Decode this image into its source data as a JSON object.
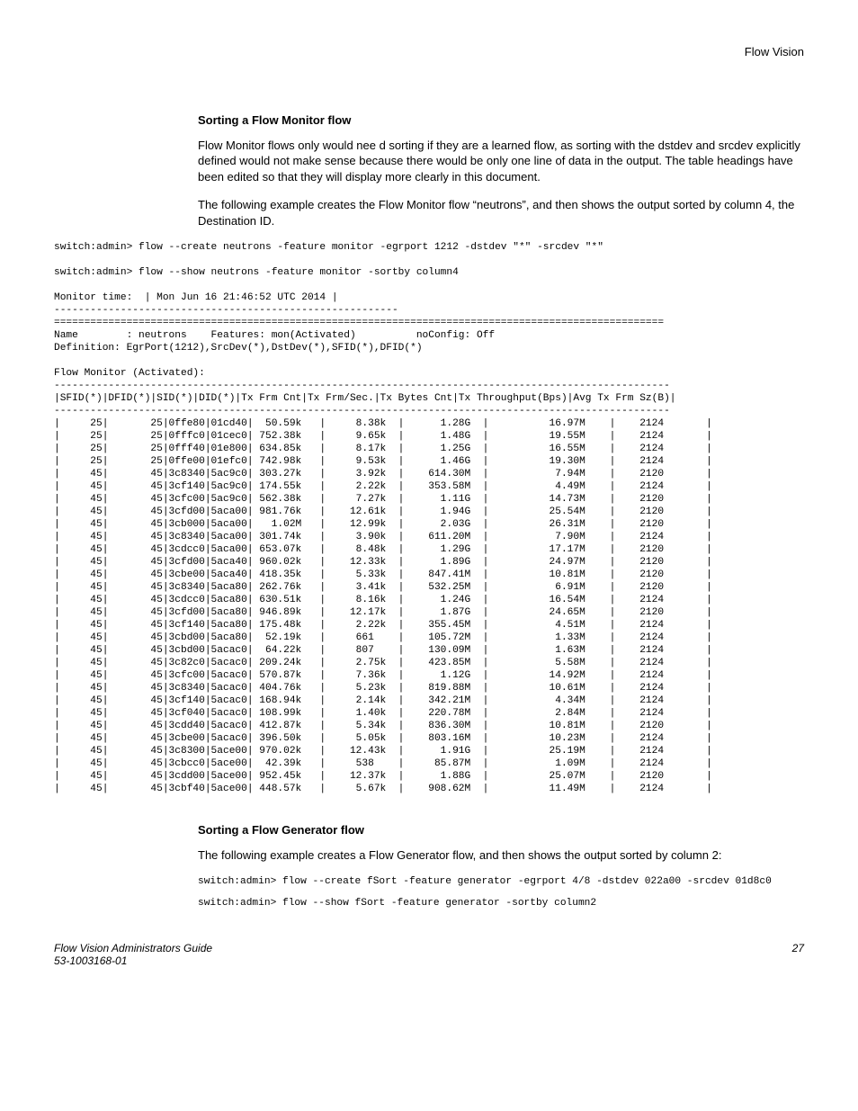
{
  "running_head": "Flow Vision",
  "section1": {
    "heading": "Sorting a Flow Monitor flow",
    "para1": "Flow Monitor flows only would nee d sorting if they are a learned flow, as sorting with the dstdev and srcdev explicitly defined would not make sense because there would be only one line of data in the output. The table headings have been edited so that they will display more clearly in this document.",
    "para2": "The following example creates the Flow Monitor flow “neutrons”, and then shows the output sorted by column 4, the Destination ID."
  },
  "console1": {
    "cmd1": "switch:admin> flow --create neutrons -feature monitor -egrport 1212 -dstdev \"*\" -srcdev \"*\"",
    "cmd2": "switch:admin> flow --show neutrons -feature monitor -sortby column4",
    "monitor_time": "Monitor time:  | Mon Jun 16 21:46:52 UTC 2014 |",
    "dash_line_short": "---------------------------------------------------------",
    "eq_line": "=====================================================================================================",
    "name_line": "Name        : neutrons    Features: mon(Activated)          noConfig: Off",
    "def_line": "Definition: EgrPort(1212),SrcDev(*),DstDev(*),SFID(*),DFID(*)",
    "blank": "",
    "flow_mon": "Flow Monitor (Activated):",
    "dash_line_long": "------------------------------------------------------------------------------------------------------",
    "header_row": "|SFID(*)|DFID(*)|SID(*)|DID(*)|Tx Frm Cnt|Tx Frm/Sec.|Tx Bytes Cnt|Tx Throughput(Bps)|Avg Tx Frm Sz(B)|",
    "rows": [
      "|     25|       25|0ffe80|01cd40|  50.59k   |     8.38k  |      1.28G  |          16.97M    |    2124       |",
      "|     25|       25|0fffc0|01cec0| 752.38k   |     9.65k  |      1.48G  |          19.55M    |    2124       |",
      "|     25|       25|0fff40|01e800| 634.85k   |     8.17k  |      1.25G  |          16.55M    |    2124       |",
      "|     25|       25|0ffe00|01efc0| 742.98k   |     9.53k  |      1.46G  |          19.30M    |    2124       |",
      "|     45|       45|3c8340|5ac9c0| 303.27k   |     3.92k  |    614.30M  |           7.94M    |    2120       |",
      "|     45|       45|3cf140|5ac9c0| 174.55k   |     2.22k  |    353.58M  |           4.49M    |    2124       |",
      "|     45|       45|3cfc00|5ac9c0| 562.38k   |     7.27k  |      1.11G  |          14.73M    |    2120       |",
      "|     45|       45|3cfd00|5aca00| 981.76k   |    12.61k  |      1.94G  |          25.54M    |    2120       |",
      "|     45|       45|3cb000|5aca00|   1.02M   |    12.99k  |      2.03G  |          26.31M    |    2120       |",
      "|     45|       45|3c8340|5aca00| 301.74k   |     3.90k  |    611.20M  |           7.90M    |    2124       |",
      "|     45|       45|3cdcc0|5aca00| 653.07k   |     8.48k  |      1.29G  |          17.17M    |    2120       |",
      "|     45|       45|3cfd00|5aca40| 960.02k   |    12.33k  |      1.89G  |          24.97M    |    2120       |",
      "|     45|       45|3cbe00|5aca40| 418.35k   |     5.33k  |    847.41M  |          10.81M    |    2120       |",
      "|     45|       45|3c8340|5aca80| 262.76k   |     3.41k  |    532.25M  |           6.91M    |    2120       |",
      "|     45|       45|3cdcc0|5aca80| 630.51k   |     8.16k  |      1.24G  |          16.54M    |    2124       |",
      "|     45|       45|3cfd00|5aca80| 946.89k   |    12.17k  |      1.87G  |          24.65M    |    2120       |",
      "|     45|       45|3cf140|5aca80| 175.48k   |     2.22k  |    355.45M  |           4.51M    |    2124       |",
      "|     45|       45|3cbd00|5aca80|  52.19k   |     661    |    105.72M  |           1.33M    |    2124       |",
      "|     45|       45|3cbd00|5acac0|  64.22k   |     807    |    130.09M  |           1.63M    |    2124       |",
      "|     45|       45|3c82c0|5acac0| 209.24k   |     2.75k  |    423.85M  |           5.58M    |    2124       |",
      "|     45|       45|3cfc00|5acac0| 570.87k   |     7.36k  |      1.12G  |          14.92M    |    2124       |",
      "|     45|       45|3c8340|5acac0| 404.76k   |     5.23k  |    819.88M  |          10.61M    |    2124       |",
      "|     45|       45|3cf140|5acac0| 168.94k   |     2.14k  |    342.21M  |           4.34M    |    2124       |",
      "|     45|       45|3cf040|5acac0| 108.99k   |     1.40k  |    220.78M  |           2.84M    |    2124       |",
      "|     45|       45|3cdd40|5acac0| 412.87k   |     5.34k  |    836.30M  |          10.81M    |    2120       |",
      "|     45|       45|3cbe00|5acac0| 396.50k   |     5.05k  |    803.16M  |          10.23M    |    2124       |",
      "|     45|       45|3c8300|5ace00| 970.02k   |    12.43k  |      1.91G  |          25.19M    |    2124       |",
      "|     45|       45|3cbcc0|5ace00|  42.39k   |     538    |     85.87M  |           1.09M    |    2124       |",
      "|     45|       45|3cdd00|5ace00| 952.45k   |    12.37k  |      1.88G  |          25.07M    |    2120       |",
      "|     45|       45|3cbf40|5ace00| 448.57k   |     5.67k  |    908.62M  |          11.49M    |    2124       |"
    ]
  },
  "section2": {
    "heading": "Sorting a Flow Generator flow",
    "para1": "The following example creates a Flow Generator flow, and then shows the output sorted by column 2:",
    "cmd1": "switch:admin> flow --create fSort -feature generator -egrport 4/8 -dstdev 022a00 -srcdev 01d8c0",
    "cmd2": "switch:admin> flow --show fSort -feature generator -sortby column2"
  },
  "footer": {
    "left1": "Flow Vision Administrators Guide",
    "left2": "53-1003168-01",
    "right": "27"
  }
}
